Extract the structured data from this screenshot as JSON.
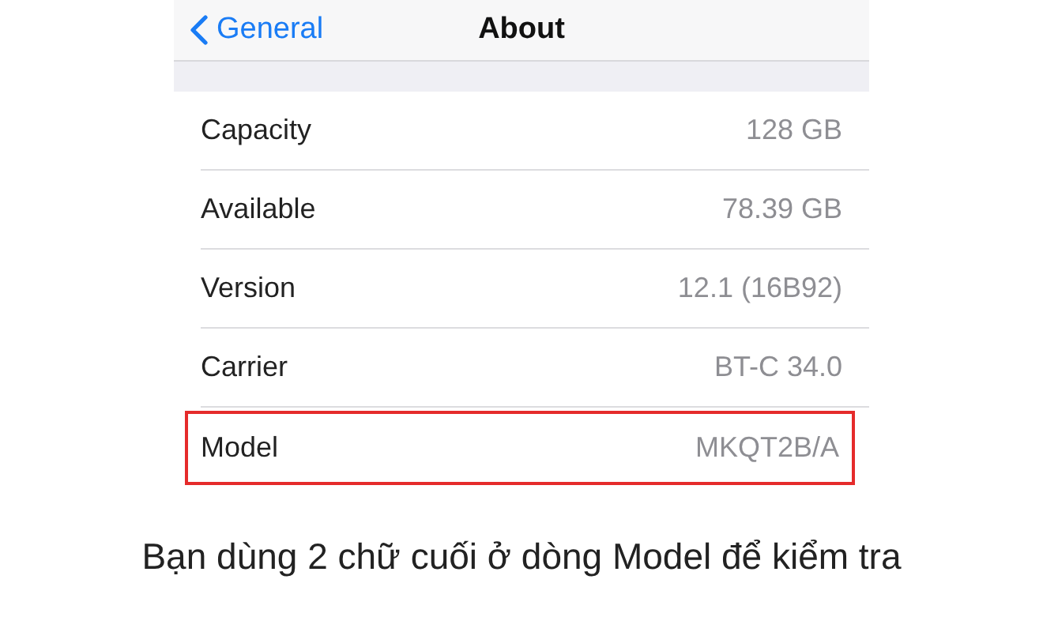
{
  "nav_bar": {
    "back": "General",
    "title": "About"
  },
  "rows": [
    {
      "label": "Capacity",
      "value": "128 GB",
      "highlighted": false
    },
    {
      "label": "Available",
      "value": "78.39 GB",
      "highlighted": false
    },
    {
      "label": "Version",
      "value": "12.1 (16B92)",
      "highlighted": false
    },
    {
      "label": "Carrier",
      "value": "BT-C 34.0",
      "highlighted": false
    },
    {
      "label": "Model",
      "value": "MKQT2B/A",
      "highlighted": true
    }
  ],
  "caption": "Bạn dùng 2 chữ cuối ở dòng Model để kiểm tra"
}
